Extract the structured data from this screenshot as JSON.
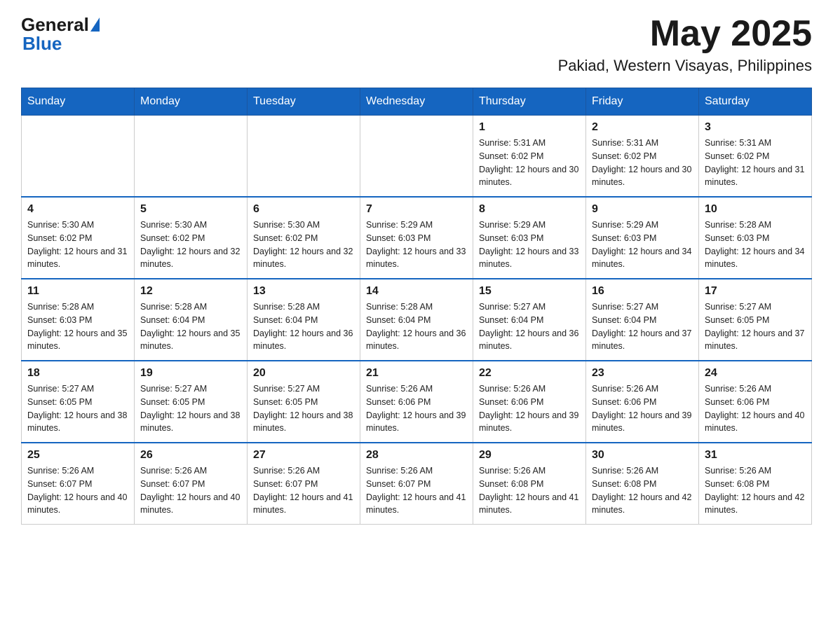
{
  "header": {
    "logo": {
      "general": "General",
      "blue": "Blue"
    },
    "month_year": "May 2025",
    "location": "Pakiad, Western Visayas, Philippines"
  },
  "calendar": {
    "days_of_week": [
      "Sunday",
      "Monday",
      "Tuesday",
      "Wednesday",
      "Thursday",
      "Friday",
      "Saturday"
    ],
    "weeks": [
      [
        {
          "day": "",
          "info": ""
        },
        {
          "day": "",
          "info": ""
        },
        {
          "day": "",
          "info": ""
        },
        {
          "day": "",
          "info": ""
        },
        {
          "day": "1",
          "info": "Sunrise: 5:31 AM\nSunset: 6:02 PM\nDaylight: 12 hours and 30 minutes."
        },
        {
          "day": "2",
          "info": "Sunrise: 5:31 AM\nSunset: 6:02 PM\nDaylight: 12 hours and 30 minutes."
        },
        {
          "day": "3",
          "info": "Sunrise: 5:31 AM\nSunset: 6:02 PM\nDaylight: 12 hours and 31 minutes."
        }
      ],
      [
        {
          "day": "4",
          "info": "Sunrise: 5:30 AM\nSunset: 6:02 PM\nDaylight: 12 hours and 31 minutes."
        },
        {
          "day": "5",
          "info": "Sunrise: 5:30 AM\nSunset: 6:02 PM\nDaylight: 12 hours and 32 minutes."
        },
        {
          "day": "6",
          "info": "Sunrise: 5:30 AM\nSunset: 6:02 PM\nDaylight: 12 hours and 32 minutes."
        },
        {
          "day": "7",
          "info": "Sunrise: 5:29 AM\nSunset: 6:03 PM\nDaylight: 12 hours and 33 minutes."
        },
        {
          "day": "8",
          "info": "Sunrise: 5:29 AM\nSunset: 6:03 PM\nDaylight: 12 hours and 33 minutes."
        },
        {
          "day": "9",
          "info": "Sunrise: 5:29 AM\nSunset: 6:03 PM\nDaylight: 12 hours and 34 minutes."
        },
        {
          "day": "10",
          "info": "Sunrise: 5:28 AM\nSunset: 6:03 PM\nDaylight: 12 hours and 34 minutes."
        }
      ],
      [
        {
          "day": "11",
          "info": "Sunrise: 5:28 AM\nSunset: 6:03 PM\nDaylight: 12 hours and 35 minutes."
        },
        {
          "day": "12",
          "info": "Sunrise: 5:28 AM\nSunset: 6:04 PM\nDaylight: 12 hours and 35 minutes."
        },
        {
          "day": "13",
          "info": "Sunrise: 5:28 AM\nSunset: 6:04 PM\nDaylight: 12 hours and 36 minutes."
        },
        {
          "day": "14",
          "info": "Sunrise: 5:28 AM\nSunset: 6:04 PM\nDaylight: 12 hours and 36 minutes."
        },
        {
          "day": "15",
          "info": "Sunrise: 5:27 AM\nSunset: 6:04 PM\nDaylight: 12 hours and 36 minutes."
        },
        {
          "day": "16",
          "info": "Sunrise: 5:27 AM\nSunset: 6:04 PM\nDaylight: 12 hours and 37 minutes."
        },
        {
          "day": "17",
          "info": "Sunrise: 5:27 AM\nSunset: 6:05 PM\nDaylight: 12 hours and 37 minutes."
        }
      ],
      [
        {
          "day": "18",
          "info": "Sunrise: 5:27 AM\nSunset: 6:05 PM\nDaylight: 12 hours and 38 minutes."
        },
        {
          "day": "19",
          "info": "Sunrise: 5:27 AM\nSunset: 6:05 PM\nDaylight: 12 hours and 38 minutes."
        },
        {
          "day": "20",
          "info": "Sunrise: 5:27 AM\nSunset: 6:05 PM\nDaylight: 12 hours and 38 minutes."
        },
        {
          "day": "21",
          "info": "Sunrise: 5:26 AM\nSunset: 6:06 PM\nDaylight: 12 hours and 39 minutes."
        },
        {
          "day": "22",
          "info": "Sunrise: 5:26 AM\nSunset: 6:06 PM\nDaylight: 12 hours and 39 minutes."
        },
        {
          "day": "23",
          "info": "Sunrise: 5:26 AM\nSunset: 6:06 PM\nDaylight: 12 hours and 39 minutes."
        },
        {
          "day": "24",
          "info": "Sunrise: 5:26 AM\nSunset: 6:06 PM\nDaylight: 12 hours and 40 minutes."
        }
      ],
      [
        {
          "day": "25",
          "info": "Sunrise: 5:26 AM\nSunset: 6:07 PM\nDaylight: 12 hours and 40 minutes."
        },
        {
          "day": "26",
          "info": "Sunrise: 5:26 AM\nSunset: 6:07 PM\nDaylight: 12 hours and 40 minutes."
        },
        {
          "day": "27",
          "info": "Sunrise: 5:26 AM\nSunset: 6:07 PM\nDaylight: 12 hours and 41 minutes."
        },
        {
          "day": "28",
          "info": "Sunrise: 5:26 AM\nSunset: 6:07 PM\nDaylight: 12 hours and 41 minutes."
        },
        {
          "day": "29",
          "info": "Sunrise: 5:26 AM\nSunset: 6:08 PM\nDaylight: 12 hours and 41 minutes."
        },
        {
          "day": "30",
          "info": "Sunrise: 5:26 AM\nSunset: 6:08 PM\nDaylight: 12 hours and 42 minutes."
        },
        {
          "day": "31",
          "info": "Sunrise: 5:26 AM\nSunset: 6:08 PM\nDaylight: 12 hours and 42 minutes."
        }
      ]
    ]
  }
}
